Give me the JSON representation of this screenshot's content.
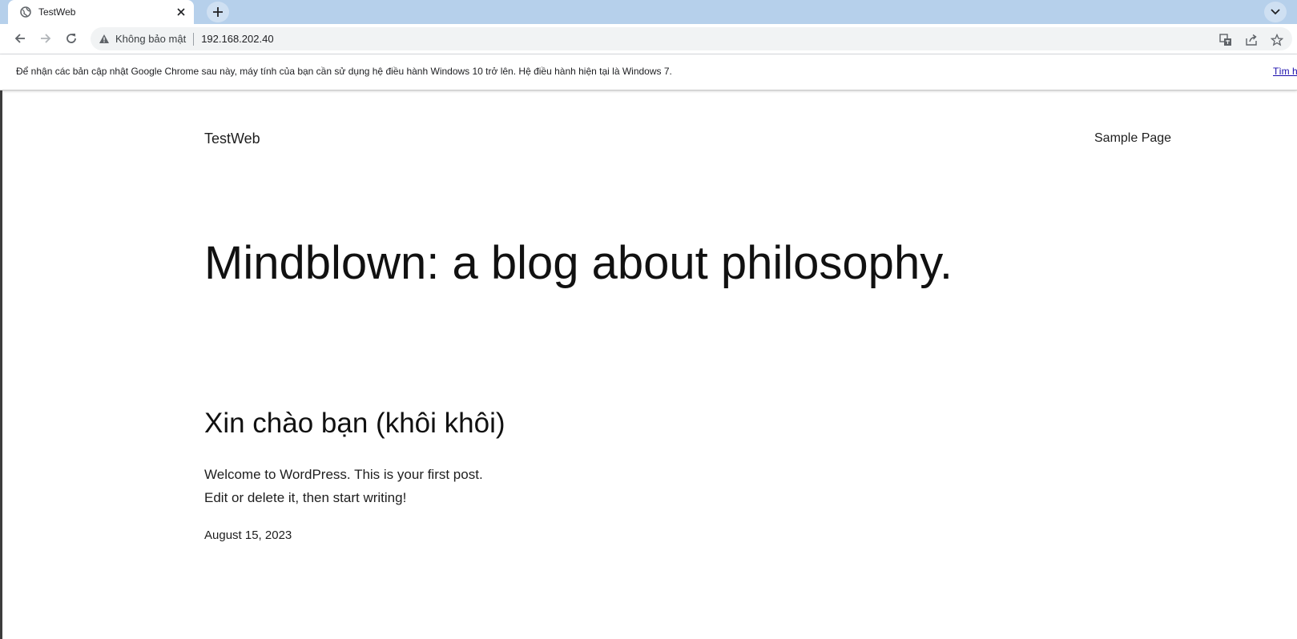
{
  "browser": {
    "tab": {
      "title": "TestWeb"
    },
    "address_bar": {
      "security_label": "Không bảo mật",
      "url": "192.168.202.40"
    }
  },
  "infobar": {
    "message": "Để nhận các bản cập nhật Google Chrome sau này, máy tính của bạn cần sử dụng hệ điều hành Windows 10 trở lên. Hệ điều hành hiện tại là Windows 7.",
    "link_label": "Tìm h"
  },
  "site": {
    "title": "TestWeb",
    "nav": [
      {
        "label": "Sample Page"
      }
    ],
    "hero": "Mindblown: a blog about philosophy."
  },
  "post": {
    "title": "Xin chào bạn (khôi khôi)",
    "excerpt_line1": "Welcome to WordPress. This is your first post.",
    "excerpt_line2": "Edit or delete it, then start writing!",
    "date": "August 15, 2023"
  },
  "colors": {
    "tabstrip": "#b6d0eb",
    "omnibox": "#f1f3f4",
    "link": "#1a0dab"
  }
}
